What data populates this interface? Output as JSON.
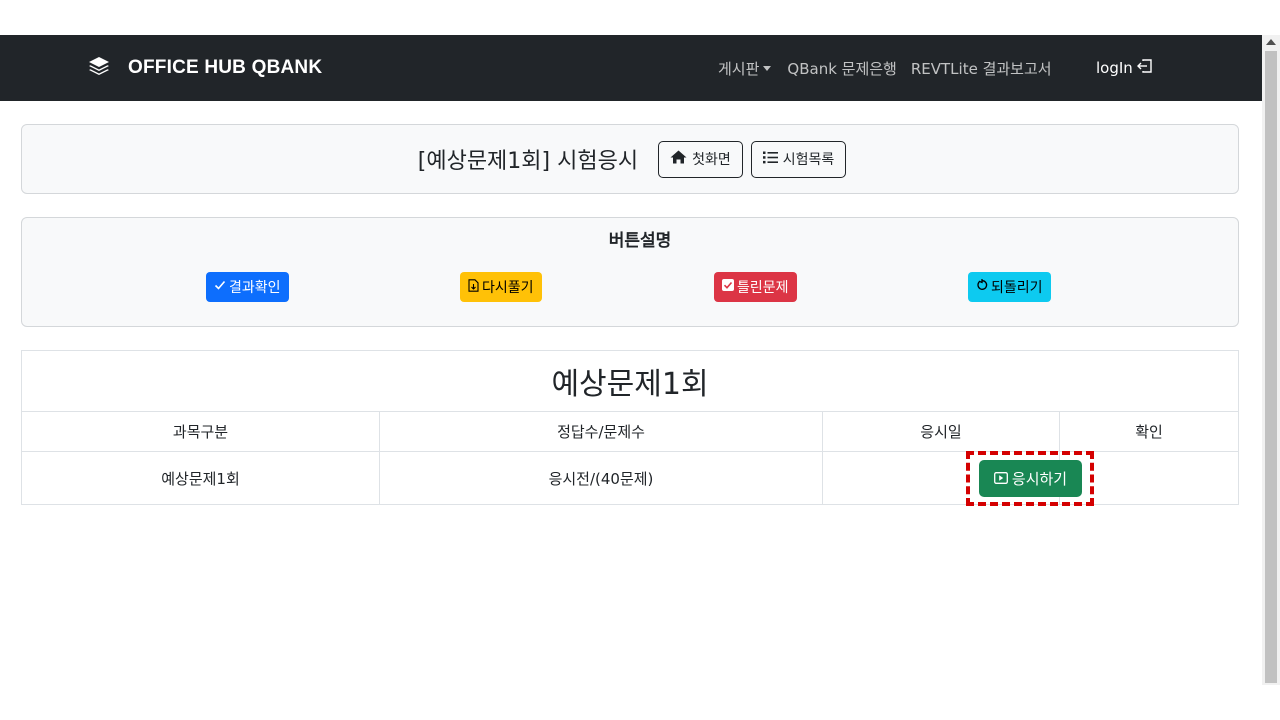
{
  "navbar": {
    "brand": "OFFICE HUB QBANK",
    "brand_icon": "layers-icon",
    "links": [
      "게시판",
      "QBank 문제은행",
      "REVTLite 결과보고서"
    ],
    "login": "logIn",
    "bg_color": "#212529"
  },
  "exam_header": {
    "title": "[예상문제1회] 시험응시",
    "home_button": "첫화면",
    "list_button": "시험목록"
  },
  "legend": {
    "title": "버튼설명",
    "buttons": [
      {
        "label": "결과확인",
        "color": "#0d6efd",
        "icon": "check-icon"
      },
      {
        "label": "다시풀기",
        "color": "#ffc107",
        "icon": "file-icon"
      },
      {
        "label": "틀린문제",
        "color": "#dc3545",
        "icon": "checkbox-icon"
      },
      {
        "label": "되돌리기",
        "color": "#0dcaf0",
        "icon": "undo-icon"
      }
    ]
  },
  "table": {
    "title": "예상문제1회",
    "headers": [
      "과목구분",
      "정답수/문제수",
      "응시일",
      "확인"
    ],
    "rows": [
      {
        "subject": "예상문제1회",
        "score": "응시전/(40문제)",
        "date": "",
        "action": "응시하기"
      }
    ]
  }
}
